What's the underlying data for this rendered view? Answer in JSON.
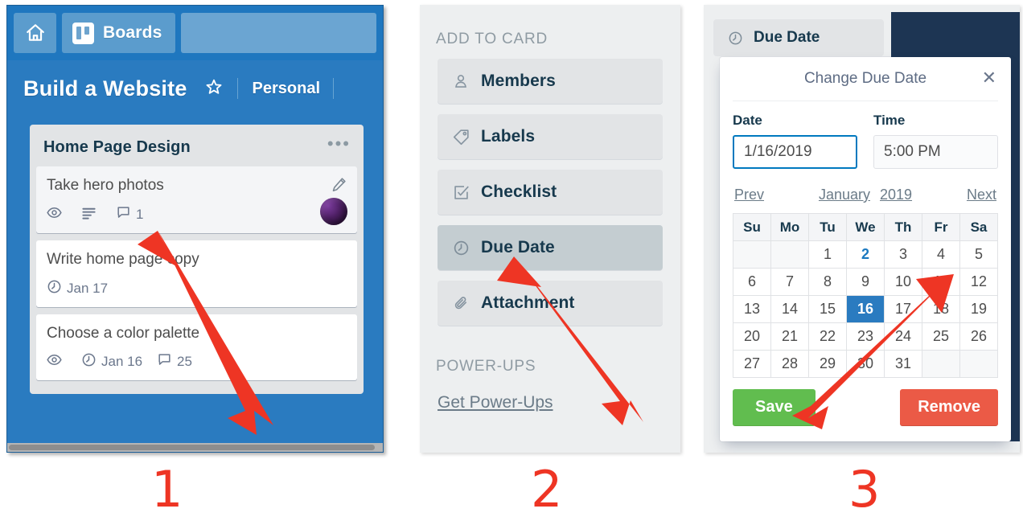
{
  "panel1": {
    "topbar": {
      "home_icon": "home-icon",
      "boards_icon": "trello-boards-icon",
      "boards_label": "Boards"
    },
    "board": {
      "title": "Build a Website",
      "star_icon": "star-icon",
      "team": "Personal"
    },
    "list": {
      "title": "Home Page Design",
      "menu_icon": "ellipsis-icon",
      "cards": [
        {
          "title": "Take hero photos",
          "hovered": true,
          "pencil_icon": "pencil-icon",
          "avatar": "member-avatar",
          "badges": [
            {
              "icon": "eye-icon",
              "text": ""
            },
            {
              "icon": "description-icon",
              "text": ""
            },
            {
              "icon": "comment-icon",
              "text": "1"
            }
          ]
        },
        {
          "title": "Write home page copy",
          "hovered": false,
          "badges": [
            {
              "icon": "clock-icon",
              "text": "Jan 17"
            }
          ]
        },
        {
          "title": "Choose a color palette",
          "hovered": false,
          "badges": [
            {
              "icon": "eye-icon",
              "text": ""
            },
            {
              "icon": "clock-icon",
              "text": "Jan 16"
            },
            {
              "icon": "comment-icon",
              "text": "25"
            }
          ]
        }
      ]
    }
  },
  "panel2": {
    "section_label": "ADD TO CARD",
    "items": [
      {
        "label": "Members",
        "icon": "person-icon",
        "active": false
      },
      {
        "label": "Labels",
        "icon": "tag-icon",
        "active": false
      },
      {
        "label": "Checklist",
        "icon": "checkbox-icon",
        "active": false
      },
      {
        "label": "Due Date",
        "icon": "clock-icon",
        "active": true
      },
      {
        "label": "Attachment",
        "icon": "paperclip-icon",
        "active": false
      }
    ],
    "powerups_label": "POWER-UPS",
    "powerups_link": "Get Power-Ups"
  },
  "panel3": {
    "due_date_button": {
      "label": "Due Date",
      "icon": "clock-icon"
    },
    "popover": {
      "title": "Change Due Date",
      "close_icon": "close-icon",
      "date_field": {
        "label": "Date",
        "value": "1/16/2019"
      },
      "time_field": {
        "label": "Time",
        "value": "5:00 PM"
      },
      "calendar": {
        "prev_label": "Prev",
        "next_label": "Next",
        "month": "January",
        "year": "2019",
        "weekdays": [
          "Su",
          "Mo",
          "Tu",
          "We",
          "Th",
          "Fr",
          "Sa"
        ],
        "weeks": [
          [
            {
              "d": "",
              "state": "empty"
            },
            {
              "d": "",
              "state": "empty"
            },
            {
              "d": "1",
              "state": "normal"
            },
            {
              "d": "2",
              "state": "today"
            },
            {
              "d": "3",
              "state": "normal"
            },
            {
              "d": "4",
              "state": "normal"
            },
            {
              "d": "5",
              "state": "normal"
            }
          ],
          [
            {
              "d": "6",
              "state": "normal"
            },
            {
              "d": "7",
              "state": "normal"
            },
            {
              "d": "8",
              "state": "normal"
            },
            {
              "d": "9",
              "state": "normal"
            },
            {
              "d": "10",
              "state": "normal"
            },
            {
              "d": "11",
              "state": "normal"
            },
            {
              "d": "12",
              "state": "normal"
            }
          ],
          [
            {
              "d": "13",
              "state": "normal"
            },
            {
              "d": "14",
              "state": "normal"
            },
            {
              "d": "15",
              "state": "normal"
            },
            {
              "d": "16",
              "state": "selected"
            },
            {
              "d": "17",
              "state": "normal"
            },
            {
              "d": "18",
              "state": "normal"
            },
            {
              "d": "19",
              "state": "normal"
            }
          ],
          [
            {
              "d": "20",
              "state": "normal"
            },
            {
              "d": "21",
              "state": "normal"
            },
            {
              "d": "22",
              "state": "normal"
            },
            {
              "d": "23",
              "state": "normal"
            },
            {
              "d": "24",
              "state": "normal"
            },
            {
              "d": "25",
              "state": "normal"
            },
            {
              "d": "26",
              "state": "normal"
            }
          ],
          [
            {
              "d": "27",
              "state": "normal"
            },
            {
              "d": "28",
              "state": "normal"
            },
            {
              "d": "29",
              "state": "normal"
            },
            {
              "d": "30",
              "state": "normal"
            },
            {
              "d": "31",
              "state": "normal"
            },
            {
              "d": "",
              "state": "empty"
            },
            {
              "d": "",
              "state": "empty"
            }
          ]
        ]
      },
      "save_label": "Save",
      "remove_label": "Remove"
    }
  },
  "annotations": {
    "steps": [
      "1",
      "2",
      "3"
    ],
    "arrow_color": "#ee3524"
  },
  "colors": {
    "trello_blue": "#2a7bc0",
    "topbar_blue": "#1f77bf",
    "list_grey": "#e2e4e6",
    "panel_bg": "#edeff0",
    "navy": "#1d3553",
    "save_green": "#61bd4f",
    "remove_red": "#eb5a46",
    "selected_blue": "#2a7bc0",
    "annotation_red": "#ee3524"
  }
}
